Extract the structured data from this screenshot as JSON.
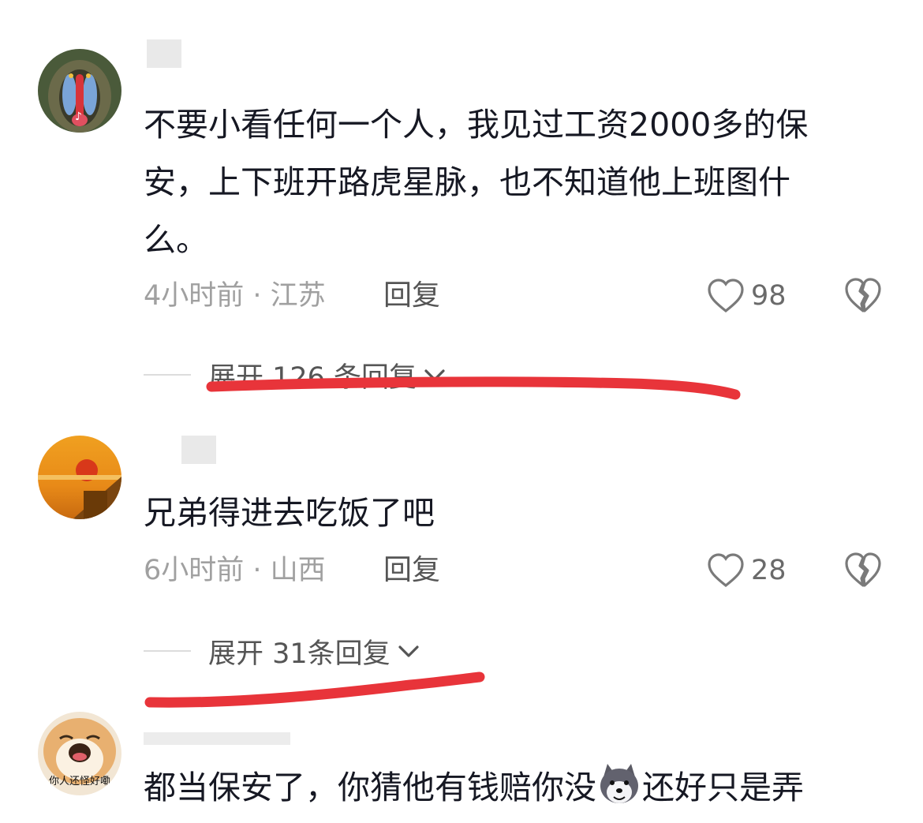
{
  "comments": [
    {
      "text": "不要小看任何一个人，我见过工资2000多的保安，上下班开路虎星脉，也不知道他上班图什么。",
      "time_location": "4小时前 · 江苏",
      "reply_label": "回复",
      "like_count": "98",
      "expand_label": "展开 126 条回复"
    },
    {
      "text": "兄弟得进去吃饭了吧",
      "time_location": "6小时前 · 山西",
      "reply_label": "回复",
      "like_count": "28",
      "expand_label": "展开 31条回复"
    },
    {
      "text_before_emoji": "都当保安了，你猜他有钱赔你没",
      "text_after_emoji": "还好只是弄",
      "avatar_caption": "你人还怪好嘞"
    }
  ],
  "icons": [
    "heart-icon",
    "broken-heart-icon",
    "chevron-down-icon",
    "husky-emoji-icon"
  ],
  "colors": {
    "text": "#161823",
    "meta": "#a0a0a0",
    "annotation_red": "#e8343a"
  }
}
